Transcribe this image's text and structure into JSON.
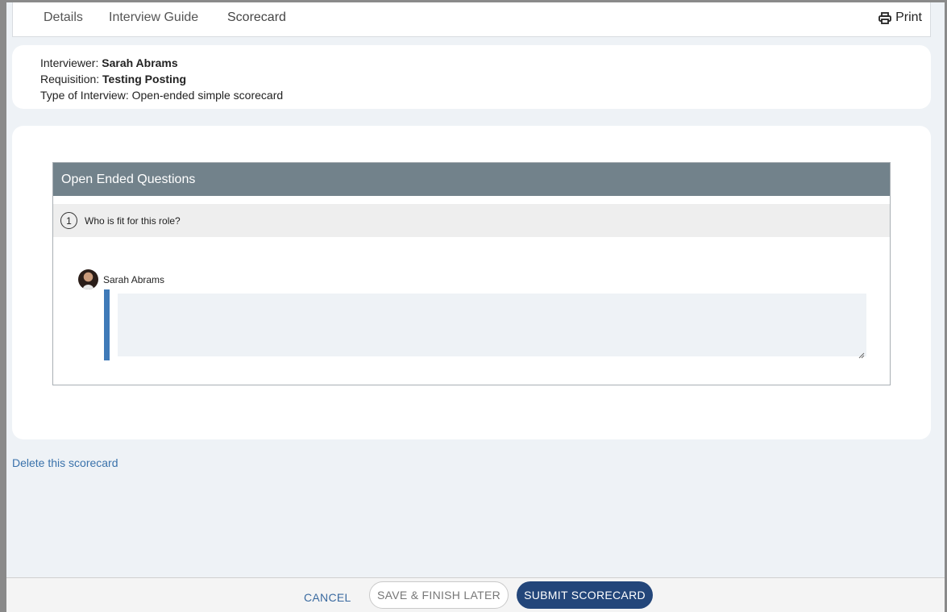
{
  "tabs": [
    {
      "label": "Details"
    },
    {
      "label": "Interview Guide"
    },
    {
      "label": "Scorecard"
    }
  ],
  "print_label": "Print",
  "info": {
    "interviewer_label": "Interviewer: ",
    "interviewer_value": "Sarah Abrams",
    "requisition_label": "Requisition: ",
    "requisition_value": "Testing Posting",
    "type_label": "Type of Interview: ",
    "type_value": "Open-ended simple scorecard"
  },
  "section": {
    "title": "Open Ended Questions",
    "questions": [
      {
        "number": "1",
        "text": "Who is fit for this role?",
        "answerer": "Sarah Abrams",
        "answer": ""
      }
    ]
  },
  "delete_link": "Delete this scorecard",
  "footer": {
    "cancel": "CANCEL",
    "save": "SAVE & FINISH LATER",
    "submit": "SUBMIT SCORECARD"
  },
  "colors": {
    "section_header": "#72828b",
    "accent_bar": "#3f7ab8",
    "submit_button": "#23467a",
    "link": "#3a72ab"
  }
}
